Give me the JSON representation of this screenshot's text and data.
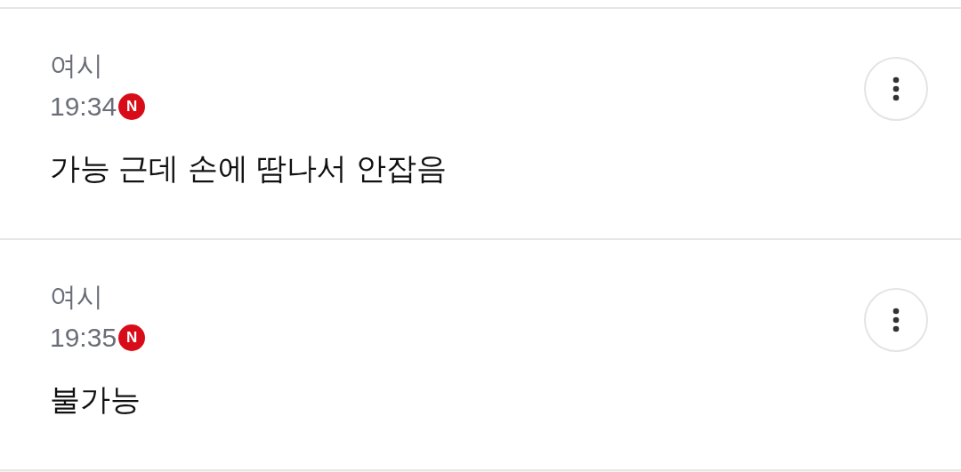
{
  "comments": [
    {
      "author": "여시",
      "time": "19:34",
      "badge": "N",
      "body": "가능 근데 손에 땀나서 안잡음"
    },
    {
      "author": "여시",
      "time": "19:35",
      "badge": "N",
      "body": "불가능"
    }
  ]
}
